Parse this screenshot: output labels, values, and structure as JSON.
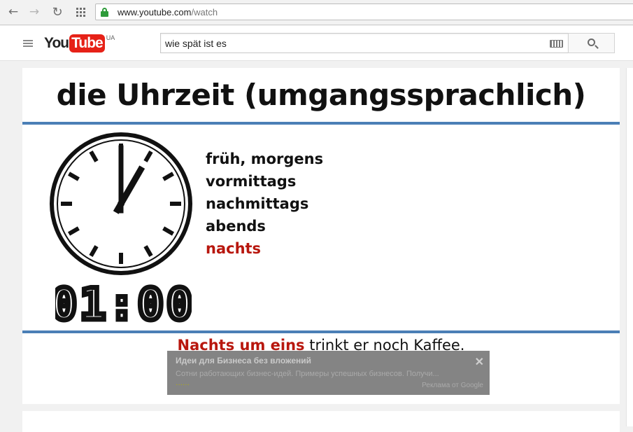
{
  "browser": {
    "url_host": "www.youtube.com",
    "url_path": "/watch",
    "back_icon": "arrow-left-icon",
    "forward_icon": "arrow-right-icon",
    "reload_icon": "reload-icon",
    "apps_icon": "apps-grid-icon"
  },
  "youtube": {
    "logo_you": "You",
    "logo_tube": "Tube",
    "country": "UA",
    "search_value": "wie spät ist es"
  },
  "video": {
    "title": "die Uhrzeit (umgangssprachlich)",
    "digital_time": "01:00",
    "clock_hour": 1,
    "clock_minute": 0,
    "times": [
      "früh, morgens",
      "vormittags",
      "nachmittags",
      "abends",
      "nachts"
    ],
    "highlighted_index": 4,
    "sentence_highlight": "Nachts um eins",
    "sentence_rest": " trinkt er noch Kaffee.",
    "accent_color": "#b8170e",
    "rule_color": "#4b7fb6"
  },
  "ad": {
    "title": "Идеи для Бизнеса без вложений",
    "description": "Сотни работающих бизнес-идей. Примеры успешных бизнесов. Получи...",
    "source": "Реклама от Google",
    "close": "✕"
  }
}
